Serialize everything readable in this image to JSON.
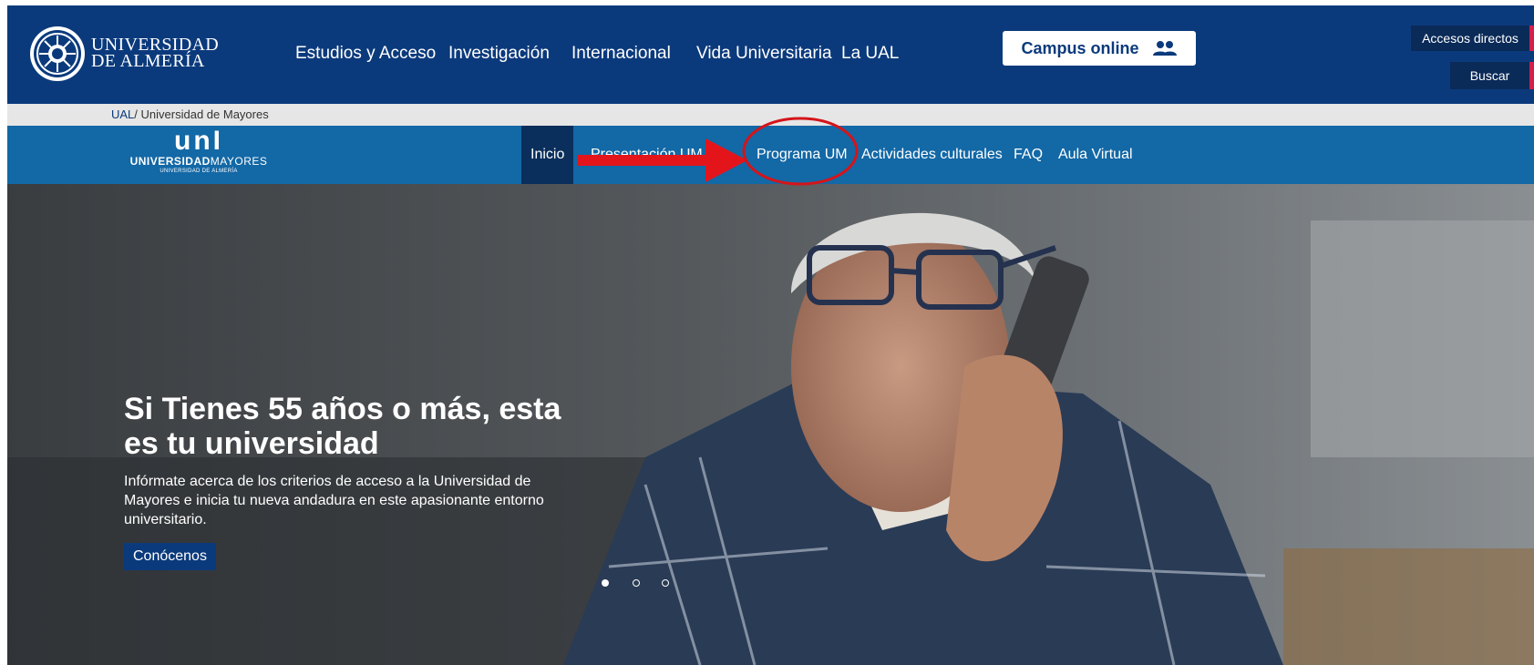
{
  "header": {
    "logo_line1": "UNIVERSIDAD",
    "logo_line2": "DE ALMERÍA",
    "nav": [
      "Estudios y Acceso",
      "Investigación",
      "Internacional",
      "Vida Universitaria",
      "La UAL"
    ],
    "campus_label": "Campus online",
    "campus_icon": "users-icon",
    "access_label": "Accesos directos",
    "search_label": "Buscar",
    "colors": {
      "primary": "#0b3a7c",
      "accent": "#d61e4a",
      "subnav": "#1368a6"
    }
  },
  "breadcrumb": {
    "root": "UAL",
    "current": "Universidad de Mayores"
  },
  "subnav": {
    "logo_uni": "unI",
    "logo_name_bold": "UNIVERSIDAD",
    "logo_name_light": "MAYORES",
    "logo_sub": "UNIVERSIDAD DE ALMERÍA",
    "items": [
      "Inicio",
      "Presentación UM",
      "Programa UM",
      "Actividades culturales",
      "FAQ",
      "Aula Virtual"
    ],
    "active_item": "Inicio",
    "highlighted_item": "Programa UM"
  },
  "hero": {
    "title": "Si Tienes 55 años o más, esta es tu universidad",
    "description": "Infórmate acerca de los criterios de acceso a la Universidad de Mayores e inicia tu nueva andadura en este apasionante entorno universitario.",
    "button": "Conócenos",
    "slides_total": 3,
    "active_slide": 1
  }
}
